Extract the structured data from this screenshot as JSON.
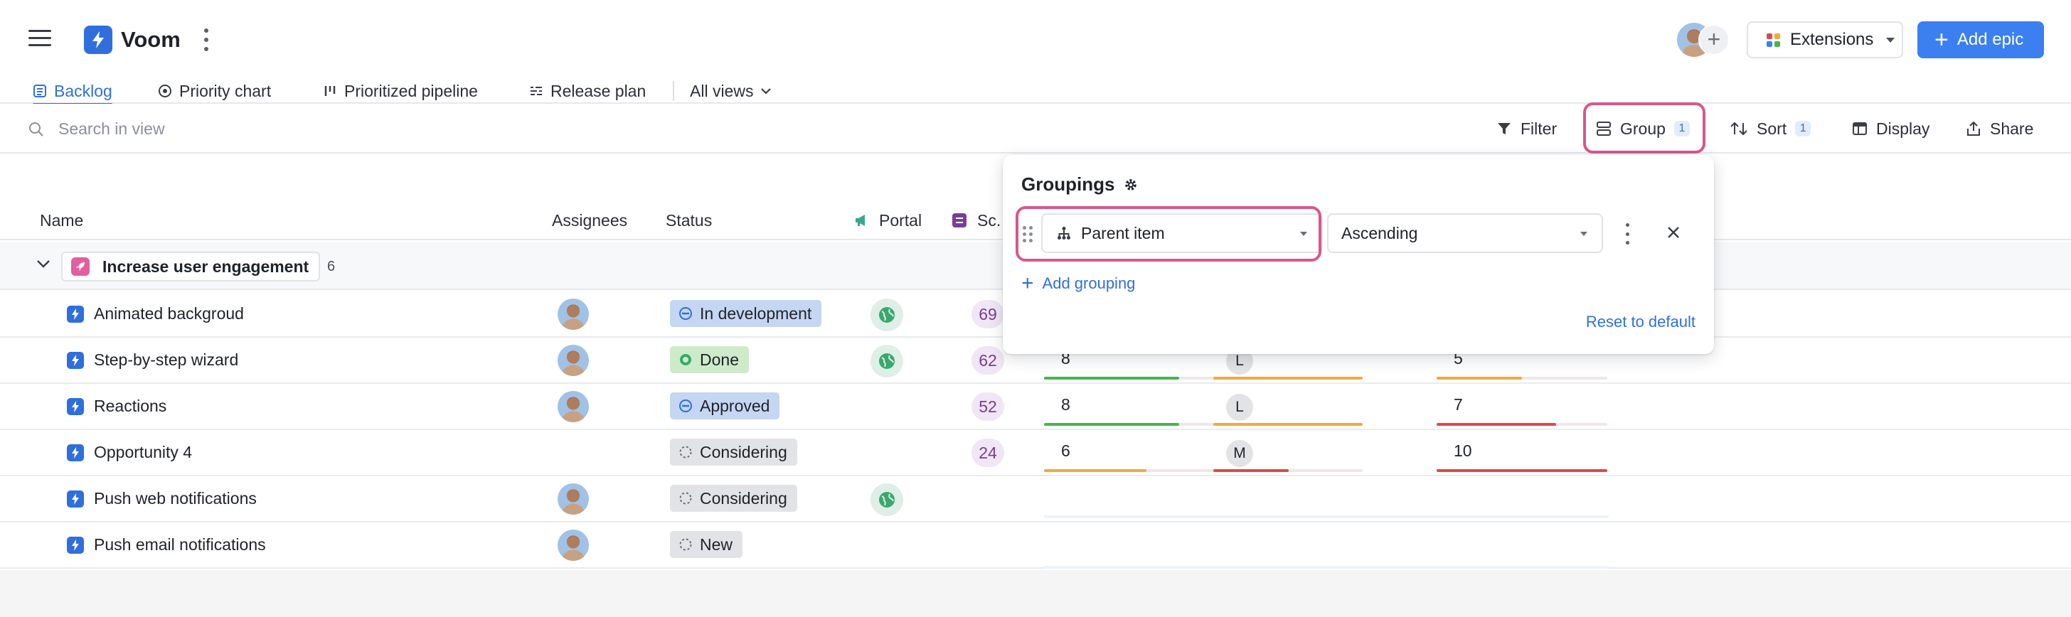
{
  "header": {
    "app_name": "Voom",
    "extensions_label": "Extensions",
    "add_epic_label": "Add epic"
  },
  "tabs": [
    {
      "label": "Backlog",
      "active": true
    },
    {
      "label": "Priority chart"
    },
    {
      "label": "Prioritized pipeline"
    },
    {
      "label": "Release plan"
    },
    {
      "label": "All views"
    }
  ],
  "toolbar": {
    "search_placeholder": "Search in view",
    "filter_label": "Filter",
    "group_label": "Group",
    "group_count": "1",
    "sort_label": "Sort",
    "sort_count": "1",
    "display_label": "Display",
    "share_label": "Share"
  },
  "columns": {
    "name": "Name",
    "assignees": "Assignees",
    "status": "Status",
    "portal": "Portal",
    "score": "Sc."
  },
  "group": {
    "name": "Increase user engagement",
    "count": "6"
  },
  "rows": [
    {
      "name": "Animated backgroud",
      "status": "In development",
      "score": "69"
    },
    {
      "name": "Step-by-step wizard",
      "status": "Done",
      "score": "62",
      "m1": "8",
      "m2": "L",
      "m3": "5"
    },
    {
      "name": "Reactions",
      "status": "Approved",
      "score": "52",
      "m1": "8",
      "m2": "L",
      "m3": "7"
    },
    {
      "name": "Opportunity 4",
      "status": "Considering",
      "score": "24",
      "m1": "6",
      "m2": "M",
      "m3": "10"
    },
    {
      "name": "Push web notifications",
      "status": "Considering"
    },
    {
      "name": "Push email notifications",
      "status": "New"
    }
  ],
  "popover": {
    "title": "Groupings",
    "field": "Parent item",
    "order": "Ascending",
    "add_label": "Add grouping",
    "reset_label": "Reset to default"
  },
  "colors": {
    "accent": "#2f6fdd",
    "primary_button": "#3b7ff0",
    "highlight": "#d9578d",
    "bar_green": "#45b649",
    "bar_orange": "#f3a83b",
    "bar_red": "#e04848"
  }
}
